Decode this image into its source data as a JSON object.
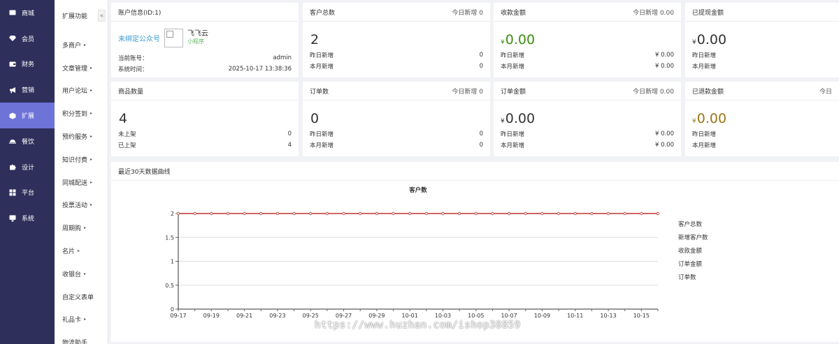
{
  "nav": {
    "items": [
      {
        "label": "商城",
        "icon": "mail-icon"
      },
      {
        "label": "会员",
        "icon": "diamond-icon"
      },
      {
        "label": "财务",
        "icon": "wallet-icon"
      },
      {
        "label": "营销",
        "icon": "megaphone-icon"
      },
      {
        "label": "扩展",
        "icon": "cube-icon"
      },
      {
        "label": "餐饮",
        "icon": "cloche-icon"
      },
      {
        "label": "设计",
        "icon": "puzzle-icon"
      },
      {
        "label": "平台",
        "icon": "grid-icon"
      },
      {
        "label": "系统",
        "icon": "monitor-icon"
      }
    ],
    "active_index": 4
  },
  "subnav": {
    "title": "扩展功能",
    "collapse_glyph": "«",
    "items": [
      {
        "label": "多商户",
        "caret": "▸"
      },
      {
        "label": "文章管理",
        "caret": "▸"
      },
      {
        "label": "用户论坛",
        "caret": "▸"
      },
      {
        "label": "积分签到",
        "caret": "▸"
      },
      {
        "label": "预约服务",
        "caret": "▸"
      },
      {
        "label": "知识付费",
        "caret": "▸"
      },
      {
        "label": "同城配送",
        "caret": "▸"
      },
      {
        "label": "投票活动",
        "caret": "▸"
      },
      {
        "label": "周期购",
        "caret": "▸"
      },
      {
        "label": "名片",
        "caret": "▸"
      },
      {
        "label": "收银台",
        "caret": "▸"
      },
      {
        "label": "自定义表单",
        "caret": ""
      },
      {
        "label": "礼品卡",
        "caret": "▸"
      },
      {
        "label": "物流助手",
        "caret": ""
      }
    ]
  },
  "account": {
    "title": "账户信息(ID:1)",
    "bind_link": "未绑定公众号",
    "app_name": "飞飞云",
    "app_type": "小程序",
    "rows": [
      {
        "label": "当前账号：",
        "value": "admin"
      },
      {
        "label": "系统时间：",
        "value": "2025-10-17 13:38:36"
      }
    ]
  },
  "stats": [
    {
      "title": "客户总数",
      "right": "今日新增 0",
      "big": "2",
      "yen": "",
      "color": "normal",
      "rows": [
        {
          "label": "昨日新增",
          "value": "0"
        },
        {
          "label": "本月新增",
          "value": "0"
        }
      ]
    },
    {
      "title": "收款金额",
      "right": "今日新增 0.00",
      "big": "0.00",
      "yen": "¥",
      "color": "green",
      "rows": [
        {
          "label": "昨日新增",
          "value": "¥ 0.00"
        },
        {
          "label": "本月新增",
          "value": "¥ 0.00"
        }
      ]
    },
    {
      "title": "已提现金额",
      "right": "",
      "big": "0.00",
      "yen": "¥",
      "color": "normal",
      "rows": [
        {
          "label": "昨日新增",
          "value": ""
        },
        {
          "label": "本月新增",
          "value": ""
        }
      ]
    },
    {
      "title": "商品数量",
      "right": "",
      "big": "4",
      "yen": "",
      "color": "normal",
      "rows": [
        {
          "label": "未上架",
          "value": "0"
        },
        {
          "label": "已上架",
          "value": "4"
        }
      ]
    },
    {
      "title": "订单数",
      "right": "今日新增 0",
      "big": "0",
      "yen": "",
      "color": "normal",
      "rows": [
        {
          "label": "昨日新增",
          "value": "0"
        },
        {
          "label": "本月新增",
          "value": "0"
        }
      ]
    },
    {
      "title": "订单金额",
      "right": "今日新增 0.00",
      "big": "0.00",
      "yen": "¥",
      "color": "normal",
      "rows": [
        {
          "label": "昨日新增",
          "value": "¥ 0.00"
        },
        {
          "label": "本月新增",
          "value": "¥ 0.00"
        }
      ]
    },
    {
      "title": "已退款金额",
      "right": "今日",
      "big": "0.00",
      "yen": "¥",
      "color": "gold",
      "rows": [
        {
          "label": "昨日新增",
          "value": ""
        },
        {
          "label": "本月新增",
          "value": ""
        }
      ]
    }
  ],
  "chart_card": {
    "title": "最近30天数据曲线"
  },
  "chart_data": {
    "type": "line",
    "title": "客户数",
    "xlabel": "",
    "ylabel": "",
    "ylim": [
      0,
      2
    ],
    "yticks": [
      "0",
      "0.5",
      "1",
      "1.5",
      "2"
    ],
    "x_tick_labels": [
      "09-17",
      "09-19",
      "09-21",
      "09-23",
      "09-25",
      "09-27",
      "09-29",
      "10-01",
      "10-03",
      "10-05",
      "10-07",
      "10-09",
      "10-11",
      "10-13",
      "10-15"
    ],
    "x": [
      "09-17",
      "09-18",
      "09-19",
      "09-20",
      "09-21",
      "09-22",
      "09-23",
      "09-24",
      "09-25",
      "09-26",
      "09-27",
      "09-28",
      "09-29",
      "09-30",
      "10-01",
      "10-02",
      "10-03",
      "10-04",
      "10-05",
      "10-06",
      "10-07",
      "10-08",
      "10-09",
      "10-10",
      "10-11",
      "10-12",
      "10-13",
      "10-14",
      "10-15",
      "10-16"
    ],
    "series": [
      {
        "name": "客户总数",
        "color": "#c23531",
        "values": [
          2,
          2,
          2,
          2,
          2,
          2,
          2,
          2,
          2,
          2,
          2,
          2,
          2,
          2,
          2,
          2,
          2,
          2,
          2,
          2,
          2,
          2,
          2,
          2,
          2,
          2,
          2,
          2,
          2,
          2
        ]
      }
    ],
    "legend": [
      "客户总数",
      "新增客户数",
      "收款金额",
      "订单金额",
      "订单数"
    ],
    "legend_position": "right",
    "grid": true
  },
  "watermark": "https://www.huzhan.com/ishop38859"
}
